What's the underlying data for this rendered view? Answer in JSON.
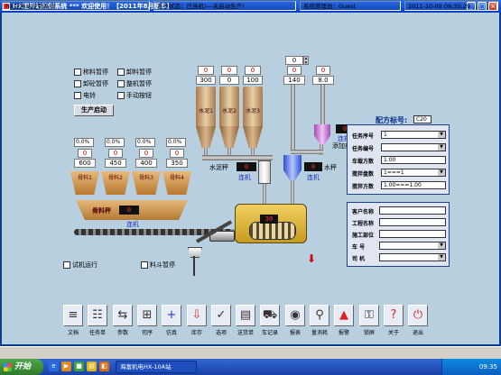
{
  "window": {
    "title": "HX搅拌站控制系统 *** 欢迎使用！【2011年8月版本】"
  },
  "checkboxes": {
    "weigh_pause": "称料暂停",
    "unload_pause": "卸料暂停",
    "bone_pause": "卸砼暂停",
    "machine_pause": "整机暂停",
    "bell": "电铃",
    "manual_button": "手动按钮",
    "trial_run": "试机运行",
    "hopper_pause": "料斗暂停"
  },
  "start_button": "生产启动",
  "silos": {
    "top_red": [
      "0",
      "0",
      "0"
    ],
    "top_black": [
      "300",
      "0",
      "100"
    ],
    "labels": [
      "水泥1",
      "水泥2",
      "水泥3"
    ],
    "cement_scale_label": "水泥秤",
    "cement_scale_value": "0",
    "cement_conn": "连机"
  },
  "water": {
    "spin": "0",
    "red": "0",
    "black": "140",
    "label": "水秤",
    "value": "0",
    "conn": "连机"
  },
  "additive": {
    "red": "0",
    "black": "8.0",
    "label": "添加剂秤",
    "value": "0",
    "conn": "连机"
  },
  "aggregates": {
    "pcts": [
      "0.0%",
      "0.0%",
      "0.0%",
      "0.0%"
    ],
    "red": [
      "0",
      "0",
      "0",
      "0"
    ],
    "black": [
      "600",
      "450",
      "400",
      "350"
    ],
    "labels": [
      "骨料1",
      "骨料2",
      "骨料3",
      "骨料4"
    ],
    "belt_label": "骨料秤",
    "belt_value": "0",
    "belt_conn": "连机"
  },
  "mixer": {
    "value": "30"
  },
  "recipe": {
    "title": "配方标号:",
    "grade": "C20",
    "rows": [
      {
        "label": "任务序号",
        "value": "1"
      },
      {
        "label": "任务编号",
        "value": ""
      },
      {
        "label": "车载方数",
        "value": "1.00"
      },
      {
        "label": "搅拌盘数",
        "value": "1===1"
      },
      {
        "label": "搅拌方数",
        "value": "1.00===1.00"
      }
    ]
  },
  "customer": {
    "rows": [
      {
        "label": "客户名称",
        "value": ""
      },
      {
        "label": "工程名称",
        "value": ""
      },
      {
        "label": "施工部位",
        "value": ""
      },
      {
        "label": "车    号",
        "value": ""
      },
      {
        "label": "司    机",
        "value": ""
      }
    ]
  },
  "toolbar": [
    {
      "icon": "doc-icon",
      "glyph": "≡",
      "label": "文档",
      "color": "#333"
    },
    {
      "icon": "task-icon",
      "glyph": "☷",
      "label": "任务单",
      "color": "#333"
    },
    {
      "icon": "params-icon",
      "glyph": "⇆",
      "label": "参数",
      "color": "#333"
    },
    {
      "icon": "mix-icon",
      "glyph": "⊞",
      "label": "司序",
      "color": "#333"
    },
    {
      "icon": "simulate-icon",
      "glyph": "+",
      "label": "仿真",
      "color": "#1a3fd8"
    },
    {
      "icon": "stock-icon",
      "glyph": "⇩",
      "label": "库存",
      "color": "#c33"
    },
    {
      "icon": "options-icon",
      "glyph": "✓",
      "label": "选项",
      "color": "#333"
    },
    {
      "icon": "delivery-icon",
      "glyph": "▤",
      "label": "送货单",
      "color": "#333"
    },
    {
      "icon": "vehicle-icon",
      "glyph": "⛟",
      "label": "车记录",
      "color": "#333"
    },
    {
      "icon": "report-icon",
      "glyph": "◉",
      "label": "报表",
      "color": "#333"
    },
    {
      "icon": "query-icon",
      "glyph": "⚲",
      "label": "量消耗",
      "color": "#333"
    },
    {
      "icon": "alarm-icon",
      "glyph": "▲",
      "label": "报警",
      "color": "#d22"
    },
    {
      "icon": "lock-icon",
      "glyph": "⚿",
      "label": "锁屏",
      "color": "#333"
    },
    {
      "icon": "about-icon",
      "glyph": "?",
      "label": "关于",
      "color": "#d22"
    },
    {
      "icon": "exit-icon",
      "glyph": "⏻",
      "label": "退出",
      "color": "#c22"
    }
  ],
  "status": {
    "app": "HX搅拌站控制系统",
    "state": "系统状态：已连机!---未启动生产!",
    "user": "系统管理员：Guest",
    "datetime": "2011-10-09 09:35:29"
  },
  "taskbar": {
    "start": "开始",
    "task": "海富机电HX-10A站",
    "clock": "09:35"
  }
}
